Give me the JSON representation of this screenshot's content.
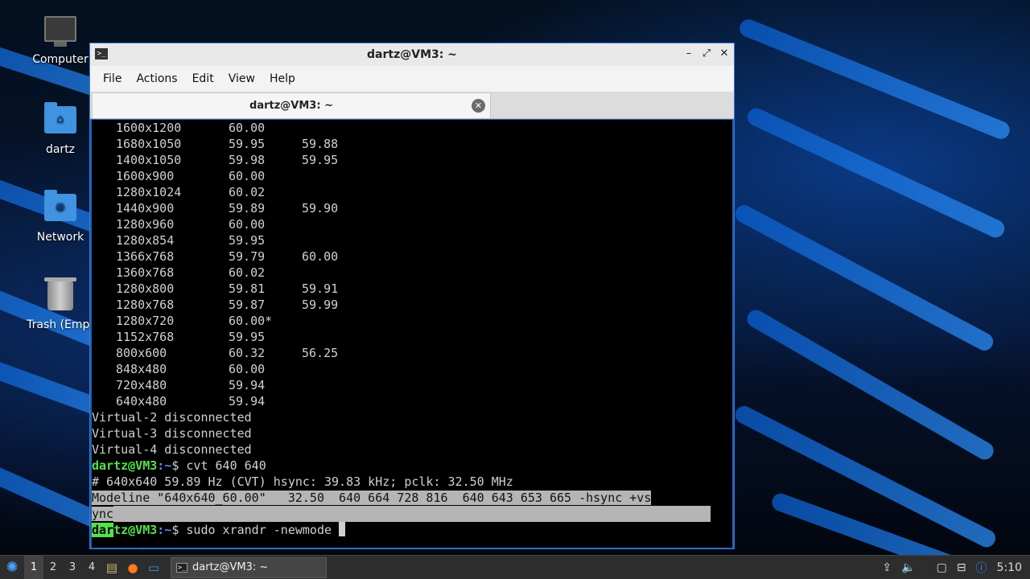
{
  "desktop": {
    "icons": [
      {
        "label": "Computer"
      },
      {
        "label": "dartz"
      },
      {
        "label": "Network"
      },
      {
        "label": "Trash (Empt"
      }
    ]
  },
  "window": {
    "title": "dartz@VM3: ~",
    "controls": {
      "minimize": "–",
      "maximize": "⤢",
      "close": "✕"
    },
    "menu": [
      "File",
      "Actions",
      "Edit",
      "View",
      "Help"
    ],
    "tab": {
      "label": "dartz@VM3: ~",
      "close": "✕"
    }
  },
  "terminal": {
    "modes": [
      {
        "res": "1600x1200",
        "r1": "60.00",
        "r2": ""
      },
      {
        "res": "1680x1050",
        "r1": "59.95",
        "r2": "59.88"
      },
      {
        "res": "1400x1050",
        "r1": "59.98",
        "r2": "59.95"
      },
      {
        "res": "1600x900",
        "r1": "60.00",
        "r2": ""
      },
      {
        "res": "1280x1024",
        "r1": "60.02",
        "r2": ""
      },
      {
        "res": "1440x900",
        "r1": "59.89",
        "r2": "59.90"
      },
      {
        "res": "1280x960",
        "r1": "60.00",
        "r2": ""
      },
      {
        "res": "1280x854",
        "r1": "59.95",
        "r2": ""
      },
      {
        "res": "1366x768",
        "r1": "59.79",
        "r2": "60.00"
      },
      {
        "res": "1360x768",
        "r1": "60.02",
        "r2": ""
      },
      {
        "res": "1280x800",
        "r1": "59.81",
        "r2": "59.91"
      },
      {
        "res": "1280x768",
        "r1": "59.87",
        "r2": "59.99"
      },
      {
        "res": "1280x720",
        "r1": "60.00*",
        "r2": ""
      },
      {
        "res": "1152x768",
        "r1": "59.95",
        "r2": ""
      },
      {
        "res": "800x600",
        "r1": "60.32",
        "r2": "56.25"
      },
      {
        "res": "848x480",
        "r1": "60.00",
        "r2": ""
      },
      {
        "res": "720x480",
        "r1": "59.94",
        "r2": ""
      },
      {
        "res": "640x480",
        "r1": "59.94",
        "r2": ""
      }
    ],
    "disconnected": [
      "Virtual-2 disconnected",
      "Virtual-3 disconnected",
      "Virtual-4 disconnected"
    ],
    "prompt_user": "dartz@VM3",
    "prompt_path": ":~",
    "prompt_sym": "$",
    "cmd1": " cvt 640 640",
    "cvt_comment": "# 640x640 59.89 Hz (CVT) hsync: 39.83 kHz; pclk: 32.50 MHz",
    "modeline_a": "Modeline ",
    "modeline_b": "\"640x640_60.00\"   32.50  640 664 728 816  640 643 653 665 -hsync +vs",
    "modeline_c": "ync",
    "prompt_user_hl": "dar",
    "prompt_user_rest": "tz@VM3",
    "cmd2": " sudo xrandr -newmode "
  },
  "taskbar": {
    "start_icon": "lubuntu-icon",
    "workspaces": [
      "1",
      "2",
      "3",
      "4"
    ],
    "task_label": "dartz@VM3: ~",
    "clock": "5:10"
  }
}
